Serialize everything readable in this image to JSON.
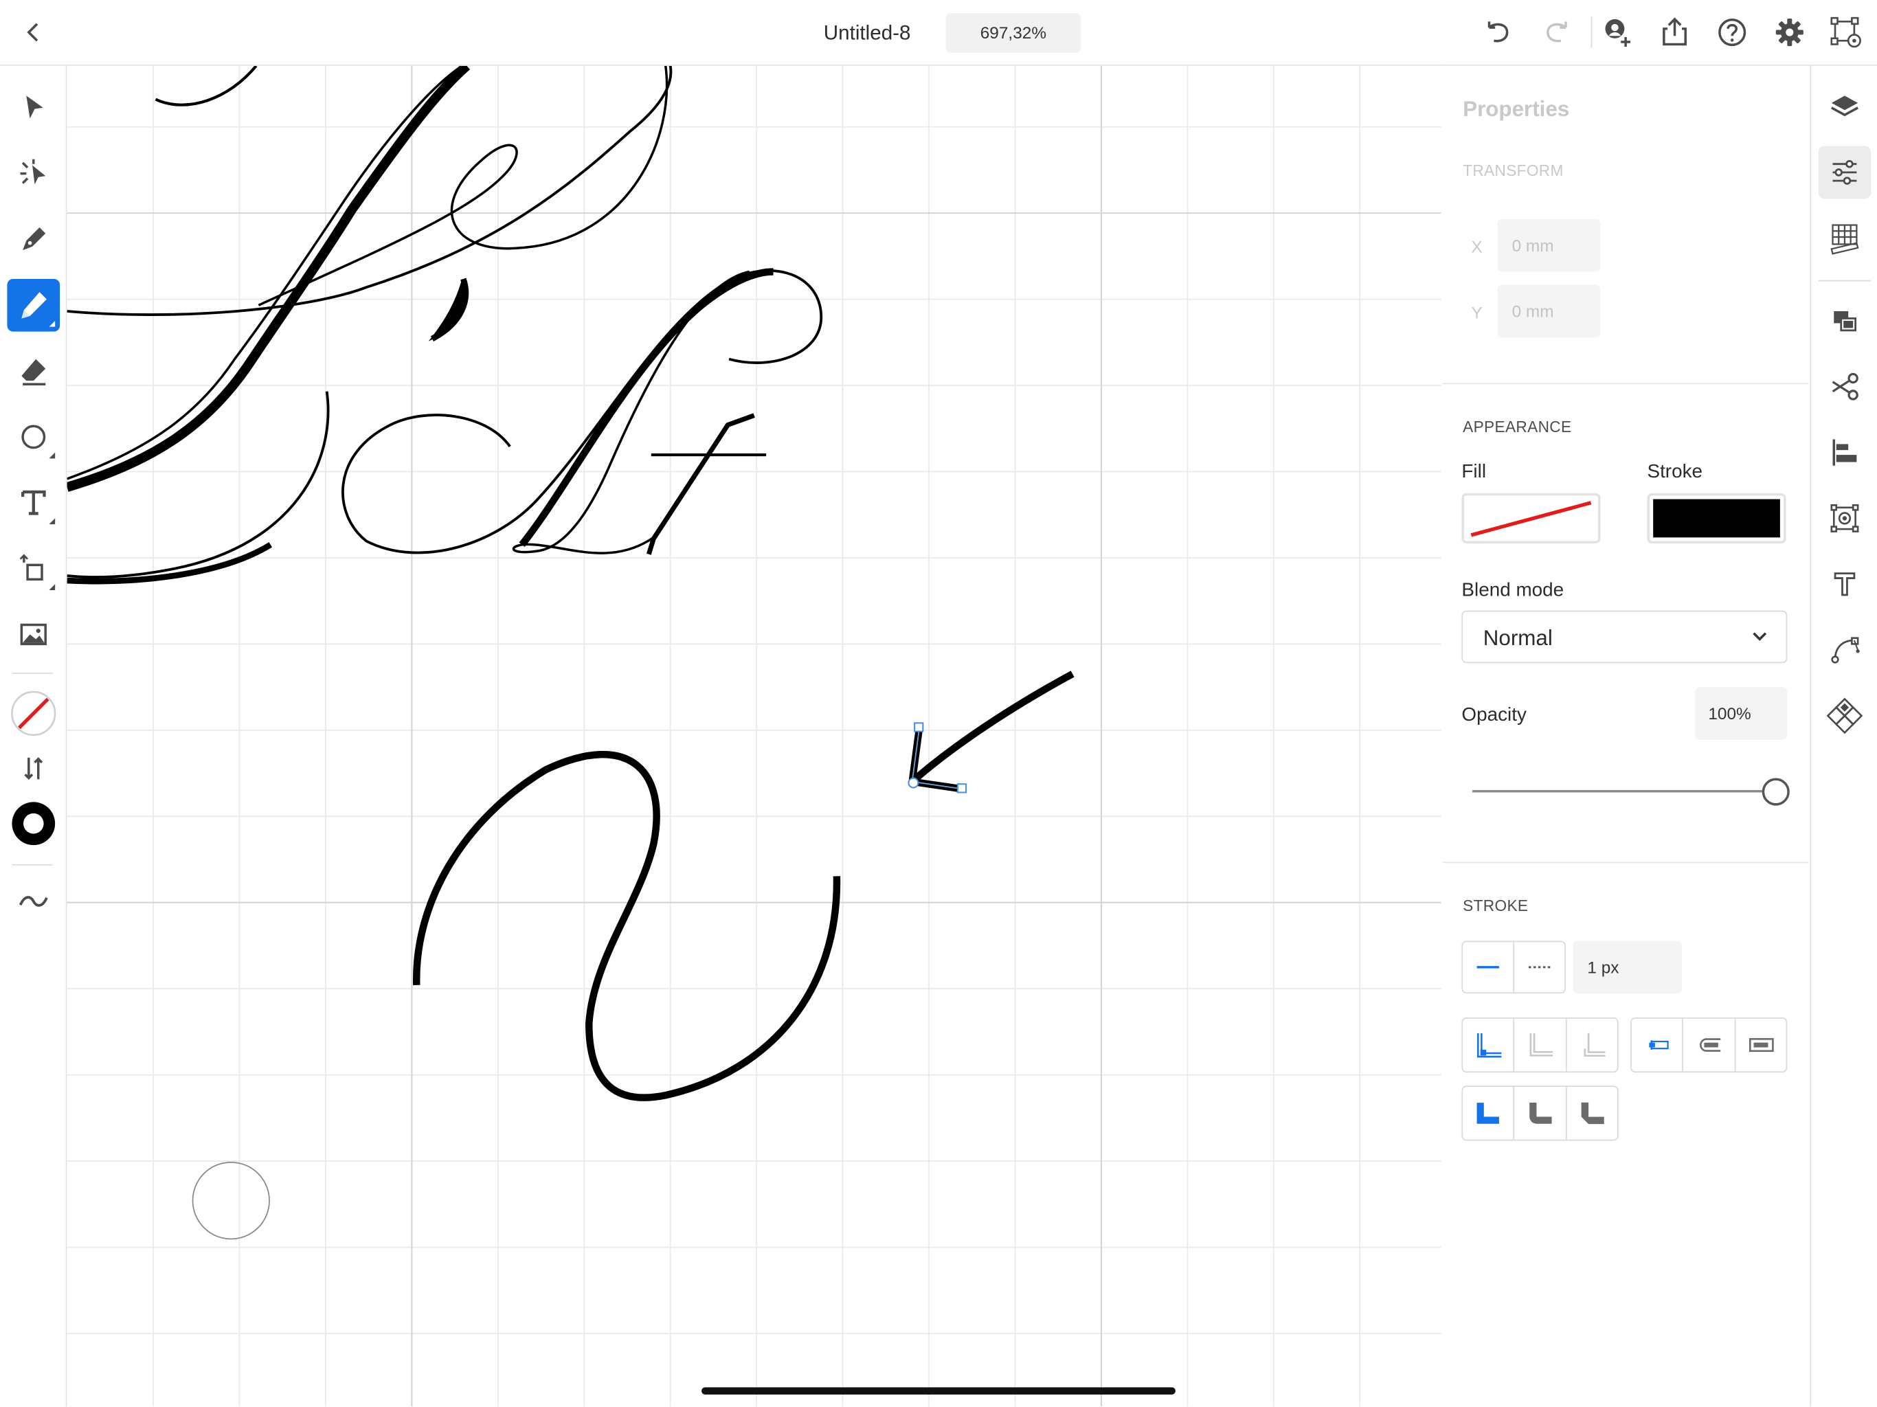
{
  "header": {
    "document_title": "Untitled-8",
    "zoom_level": "697,32%"
  },
  "properties": {
    "title": "Properties",
    "transform": {
      "section_label": "TRANSFORM",
      "x_label": "X",
      "x_value": "0 mm",
      "y_label": "Y",
      "y_value": "0 mm"
    },
    "appearance": {
      "section_label": "APPEARANCE",
      "fill_label": "Fill",
      "stroke_label": "Stroke",
      "stroke_color": "#000000",
      "fill_none_color": "#e21b1b",
      "blend_mode_label": "Blend mode",
      "blend_mode_value": "Normal",
      "opacity_label": "Opacity",
      "opacity_value": "100%",
      "opacity_fraction": 1.0
    },
    "stroke": {
      "section_label": "STROKE",
      "width_value": "1 px"
    }
  },
  "colors": {
    "accent": "#1473e6",
    "icon": "#4b4b4b"
  }
}
